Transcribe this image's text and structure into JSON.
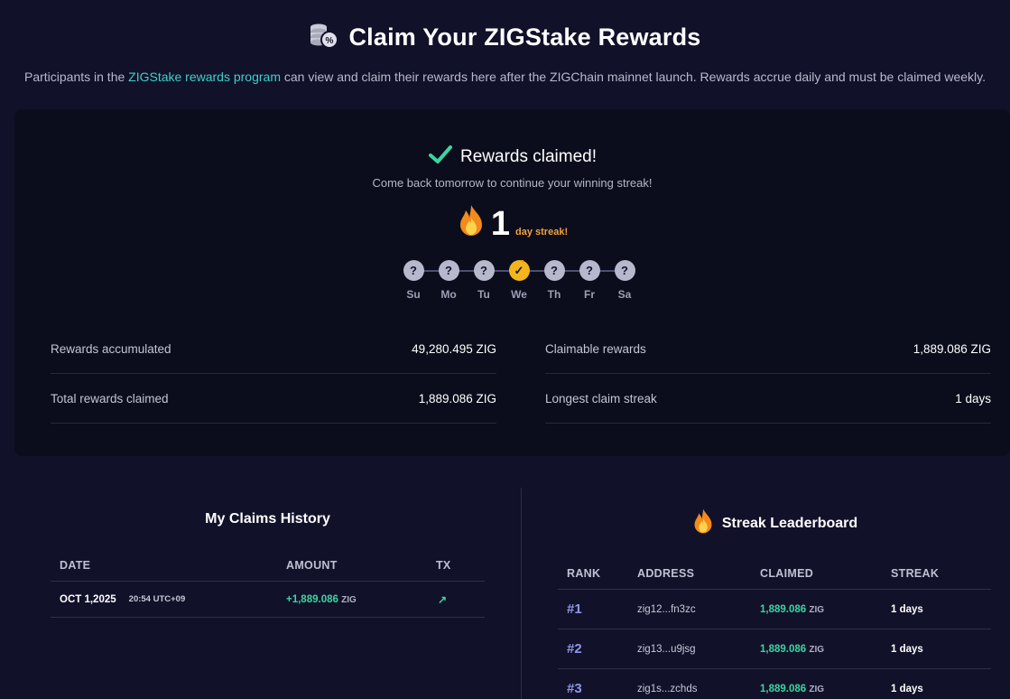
{
  "header": {
    "title": "Claim Your ZIGStake Rewards",
    "subtitle_pre": "Participants in the ",
    "subtitle_link": "ZIGStake rewards program",
    "subtitle_post": " can view and claim their rewards here after the ZIGChain mainnet launch. Rewards accrue daily and must be claimed weekly.",
    "icon": "coins-percent-icon"
  },
  "status": {
    "claimed_text": "Rewards claimed!",
    "comeback_text": "Come back tomorrow to continue your winning streak!",
    "streak_number": "1",
    "streak_label": "day streak!"
  },
  "week": {
    "days": [
      {
        "label": "Su",
        "mark": "?",
        "done": false
      },
      {
        "label": "Mo",
        "mark": "?",
        "done": false
      },
      {
        "label": "Tu",
        "mark": "?",
        "done": false
      },
      {
        "label": "We",
        "mark": "✓",
        "done": true
      },
      {
        "label": "Th",
        "mark": "?",
        "done": false
      },
      {
        "label": "Fr",
        "mark": "?",
        "done": false
      },
      {
        "label": "Sa",
        "mark": "?",
        "done": false
      }
    ]
  },
  "stats": {
    "left": [
      {
        "label": "Rewards accumulated",
        "value": "49,280.495 ZIG"
      },
      {
        "label": "Total rewards claimed",
        "value": "1,889.086 ZIG"
      }
    ],
    "right": [
      {
        "label": "Claimable rewards",
        "value": "1,889.086 ZIG"
      },
      {
        "label": "Longest claim streak",
        "value": "1 days"
      }
    ]
  },
  "history": {
    "title": "My Claims History",
    "columns": [
      "DATE",
      "AMOUNT",
      "TX"
    ],
    "rows": [
      {
        "date": "OCT 1,2025",
        "time": "20:54 UTC+09",
        "amount": "+1,889.086",
        "unit": "ZIG",
        "tx": "↗"
      }
    ]
  },
  "leaderboard": {
    "title": "Streak Leaderboard",
    "columns": [
      "RANK",
      "ADDRESS",
      "CLAIMED",
      "STREAK"
    ],
    "rows": [
      {
        "rank": "#1",
        "address": "zig12...fn3zc",
        "claimed": "1,889.086",
        "unit": "ZIG",
        "streak": "1 days"
      },
      {
        "rank": "#2",
        "address": "zig13...u9jsg",
        "claimed": "1,889.086",
        "unit": "ZIG",
        "streak": "1 days"
      },
      {
        "rank": "#3",
        "address": "zig1s...zchds",
        "claimed": "1,889.086",
        "unit": "ZIG",
        "streak": "1 days"
      }
    ]
  },
  "colors": {
    "background": "#12112a",
    "card": "#0b0d1c",
    "accent_teal": "#3fd1c4",
    "green": "#3dd4a0",
    "gold": "#f2b51c",
    "rank_purple": "#8f97e8"
  }
}
